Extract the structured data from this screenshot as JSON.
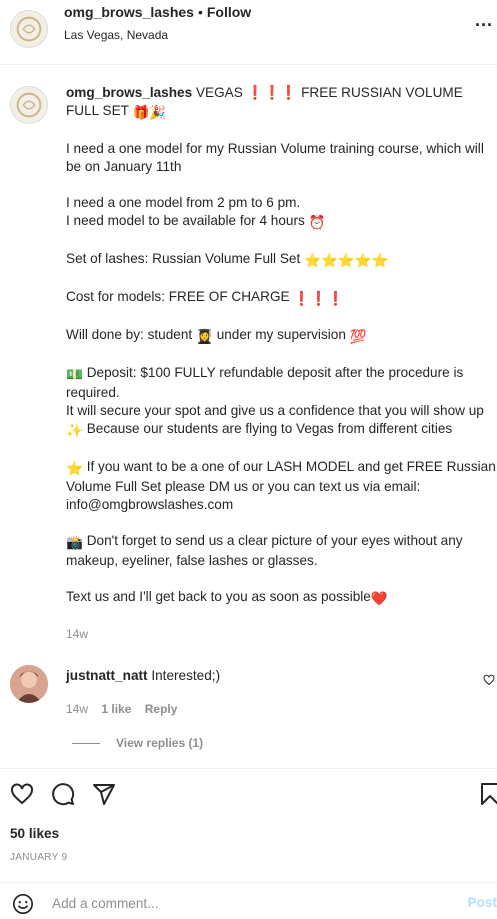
{
  "header": {
    "username": "omg_brows_lashes",
    "separator": "•",
    "follow_label": "Follow",
    "location": "Las Vegas, Nevada",
    "more_label": "..."
  },
  "caption": {
    "username": "omg_brows_lashes",
    "title_text": "VEGAS ❗❗❗ FREE RUSSIAN VOLUME FULL SET",
    "title_emoji": "🎁🎉",
    "para1": "I need a one model for my Russian Volume training course, which will be on January 11th",
    "para2_line1": "I need a one model from 2 pm to 6 pm.",
    "para2_line2": "I need model to be available for 4 hours",
    "para2_emoji": "⏰",
    "para3": "Set of lashes: Russian Volume Full Set",
    "para3_emoji": "⭐⭐⭐⭐⭐",
    "para4": "Cost for models: FREE OF CHARGE",
    "para4_emoji": "❗❗❗",
    "para5": "Will done by: student",
    "para5_emoji1": "👩‍🎓",
    "para5_tail": "under my supervision",
    "para5_emoji2": "💯",
    "para6_emoji": "💵",
    "para6": "Deposit: $100 FULLY refundable deposit after the procedure is required.",
    "para6b": "It will secure your spot and give us a confidence that you will show up",
    "para6b_emoji": "✨",
    "para6c": "Because our students are flying to Vegas from different cities",
    "para7_emoji": "⭐",
    "para7": "If you want to be a one of our LASH MODEL and get FREE Russian Volume Full Set please DM us or you can text us via email: info@omgbrowslashes.com",
    "para8_emoji": "📸",
    "para8": "Don't forget to send us a clear picture of your eyes without any makeup, eyeliner, false lashes or glasses.",
    "para9": "Text us and I'll get back to you as soon as possible",
    "para9_emoji": "❤️",
    "time_ago": "14w"
  },
  "comment": {
    "username": "justnatt_natt",
    "text": "Interested;)",
    "time_ago": "14w",
    "likes": "1 like",
    "reply_label": "Reply",
    "view_replies": "View replies (1)"
  },
  "actions": {
    "likes": "50 likes",
    "date": "JANUARY 9"
  },
  "comment_bar": {
    "placeholder": "Add a comment...",
    "post_label": "Post"
  }
}
